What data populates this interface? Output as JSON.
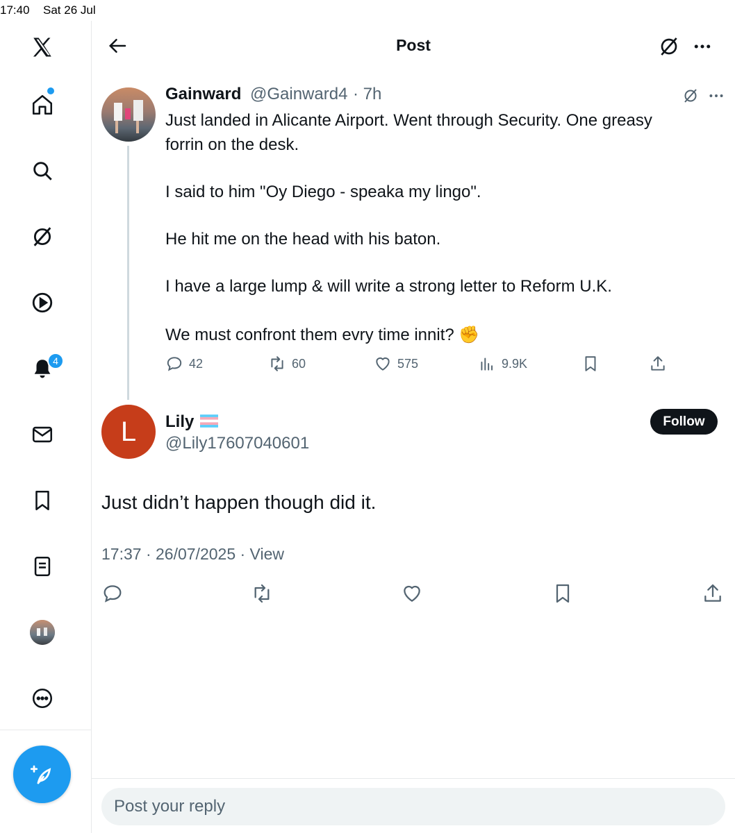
{
  "status_bar": {
    "time": "17:40",
    "date": "Sat 26 Jul"
  },
  "sidebar": {
    "items": [
      {
        "name": "home-icon"
      },
      {
        "name": "search-icon"
      },
      {
        "name": "grok-icon"
      },
      {
        "name": "video-icon"
      },
      {
        "name": "notifications-icon",
        "badge": "4"
      },
      {
        "name": "messages-icon"
      },
      {
        "name": "bookmarks-icon"
      },
      {
        "name": "lists-icon"
      },
      {
        "name": "profile-avatar"
      },
      {
        "name": "more-icon"
      }
    ],
    "compose_icon": "compose-feather-icon"
  },
  "header": {
    "title": "Post"
  },
  "parent_post": {
    "name": "Gainward",
    "handle": "@Gainward4",
    "time": "· 7h",
    "lines": [
      "Just landed in Alicante Airport. Went through Security. One greasy",
      "forrin on the desk.",
      "I said to him \"Oy Diego - speaka my lingo\".",
      "He hit me on the head with his baton.",
      "I have a large lump & will write a strong letter to Reform U.K.",
      "We must confront them evry time innit? ✊"
    ],
    "stats": {
      "replies": "42",
      "reposts": "60",
      "likes": "575",
      "views": "9.9K"
    }
  },
  "reply_post": {
    "avatar_letter": "L",
    "name": "Lily",
    "handle": "@Lily17607040601",
    "follow_label": "Follow",
    "text": "Just didn’t happen though did it.",
    "timestamp": "17:37 · 26/07/2025 · View"
  },
  "reply_box": {
    "placeholder": "Post your reply"
  },
  "colors": {
    "accent": "#1d9bf0",
    "text": "#0f1419",
    "muted": "#536471",
    "avatar_bg": "#c63d1a"
  }
}
